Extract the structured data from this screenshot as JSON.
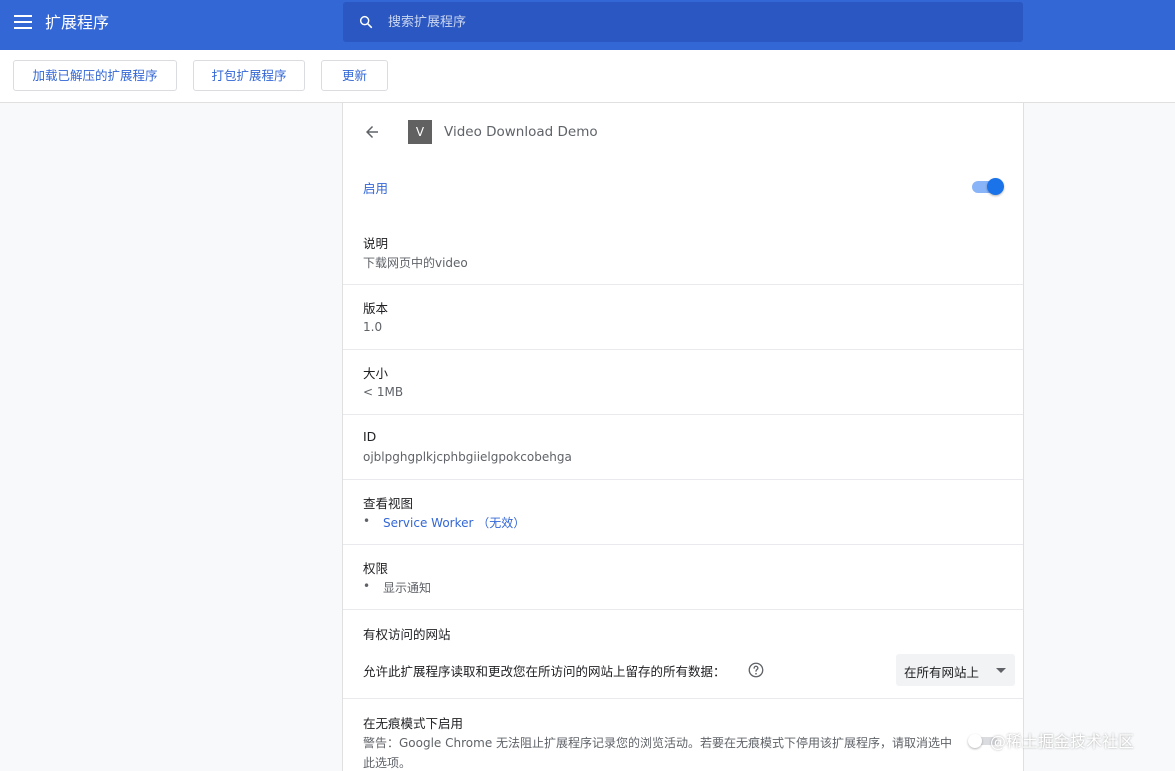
{
  "header": {
    "title": "扩展程序",
    "search_placeholder": "搜索扩展程序",
    "bg_color": "#3367d6"
  },
  "toolbar": {
    "load_unpacked": "加载已解压的扩展程序",
    "pack": "打包扩展程序",
    "update": "更新"
  },
  "extension": {
    "icon_letter": "V",
    "name": "Video Download Demo",
    "enable_label": "启用",
    "enabled": true,
    "description_label": "说明",
    "description": "下载网页中的video",
    "version_label": "版本",
    "version": "1.0",
    "size_label": "大小",
    "size": "< 1MB",
    "id_label": "ID",
    "id": "ojblpghgplkjcphbgiielgpokcobehga",
    "views_label": "查看视图",
    "views": [
      "Service Worker （无效）"
    ],
    "permissions_label": "权限",
    "permissions": [
      "显示通知"
    ],
    "site_access_label": "有权访问的网站",
    "site_access_desc": "允许此扩展程序读取和更改您在所访问的网站上留存的所有数据：",
    "site_access_value": "在所有网站上",
    "incognito_label": "在无痕模式下启用",
    "incognito_warning": "警告：Google Chrome 无法阻止扩展程序记录您的浏览活动。若要在无痕模式下停用该扩展程序，请取消选中此选项。"
  },
  "watermark": "@稀土掘金技术社区",
  "colors": {
    "accent": "#3367d6",
    "toggle_on": "#1a73e8"
  }
}
